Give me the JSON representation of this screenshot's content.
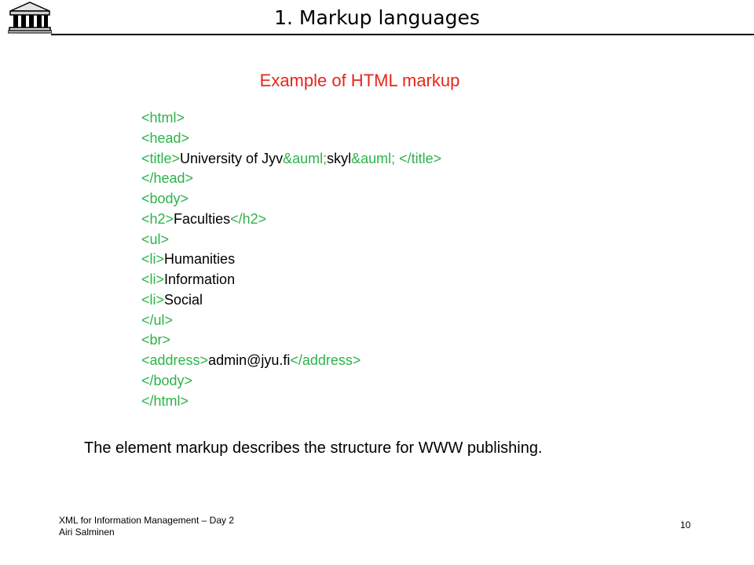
{
  "header": {
    "title": "1. Markup languages",
    "logo_icon": "greek-temple-icon"
  },
  "colors": {
    "tag": "#2db34a",
    "text": "#000000",
    "heading": "#e8251c",
    "rule": "#000000"
  },
  "heading": "Example of HTML markup",
  "code_lines": [
    [
      {
        "t": "<html>",
        "k": "tag"
      }
    ],
    [
      {
        "t": "<head>",
        "k": "tag"
      }
    ],
    [
      {
        "t": "<title>",
        "k": "tag"
      },
      {
        "t": "University of Jyv",
        "k": "text"
      },
      {
        "t": "&auml;",
        "k": "tag"
      },
      {
        "t": "skyl",
        "k": "text"
      },
      {
        "t": "&auml;",
        "k": "tag"
      },
      {
        "t": " ",
        "k": "text"
      },
      {
        "t": "</title>",
        "k": "tag"
      }
    ],
    [
      {
        "t": "</head>",
        "k": "tag"
      }
    ],
    [
      {
        "t": "<body>",
        "k": "tag"
      }
    ],
    [
      {
        "t": "<h2>",
        "k": "tag"
      },
      {
        "t": "Faculties",
        "k": "text"
      },
      {
        "t": "</h2>",
        "k": "tag"
      }
    ],
    [
      {
        "t": "<ul>",
        "k": "tag"
      }
    ],
    [
      {
        "t": "<li>",
        "k": "tag"
      },
      {
        "t": "Humanities",
        "k": "text"
      }
    ],
    [
      {
        "t": "<li>",
        "k": "tag"
      },
      {
        "t": "Information",
        "k": "text"
      }
    ],
    [
      {
        "t": "<li>",
        "k": "tag"
      },
      {
        "t": "Social",
        "k": "text"
      }
    ],
    [
      {
        "t": "</ul>",
        "k": "tag"
      }
    ],
    [
      {
        "t": "<br>",
        "k": "tag"
      }
    ],
    [
      {
        "t": "<address>",
        "k": "tag"
      },
      {
        "t": "admin@jyu.fi",
        "k": "text"
      },
      {
        "t": "</address>",
        "k": "tag"
      }
    ],
    [
      {
        "t": "</body>",
        "k": "tag"
      }
    ],
    [
      {
        "t": "</html>",
        "k": "tag"
      }
    ]
  ],
  "caption": "The element markup describes the structure for WWW publishing.",
  "footer": {
    "course": "XML for Information Management – Day 2",
    "author": "Airi Salminen",
    "page": "10"
  }
}
